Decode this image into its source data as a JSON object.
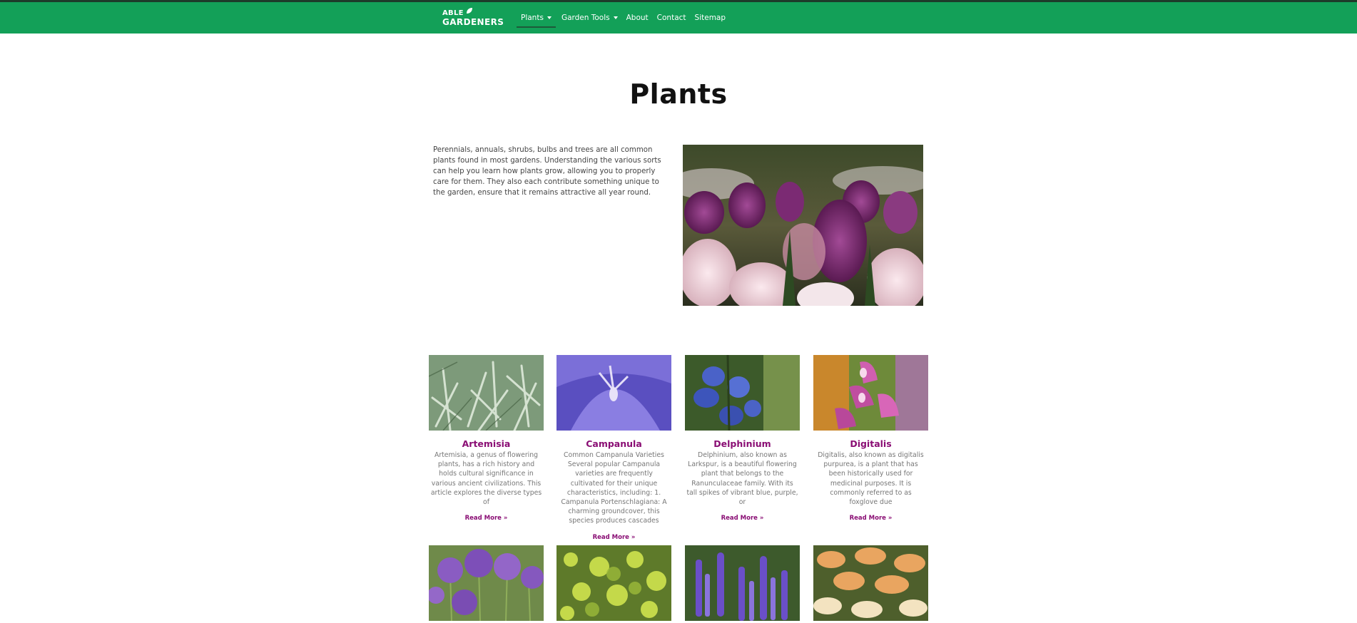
{
  "header": {
    "logo": {
      "line1": "ABLE",
      "line2": "GARDENERS"
    },
    "nav": [
      {
        "label": "Plants",
        "has_dropdown": true,
        "active": true
      },
      {
        "label": "Garden Tools",
        "has_dropdown": true,
        "active": false
      },
      {
        "label": "About",
        "has_dropdown": false,
        "active": false
      },
      {
        "label": "Contact",
        "has_dropdown": false,
        "active": false
      },
      {
        "label": "Sitemap",
        "has_dropdown": false,
        "active": false
      }
    ]
  },
  "main": {
    "title": "Plants",
    "intro": "Perennials, annuals, shrubs, bulbs and trees are all common plants found in most gardens. Understanding the various sorts can help you learn how plants grow, allowing you to properly care for them. They also each contribute something unique to the garden, ensure that it remains attractive all year round."
  },
  "cards": [
    {
      "title": "Artemisia",
      "desc": "Artemisia, a genus of flowering plants, has a rich history and holds cultural significance in various ancient civilizations. This article explores the diverse types of",
      "link": "Read More »"
    },
    {
      "title": "Campanula",
      "desc": "Common Campanula Varieties Several popular Campanula varieties are frequently cultivated for their unique characteristics, including: 1. Campanula Portenschlagiana: A charming groundcover, this species produces cascades",
      "link": "Read More »"
    },
    {
      "title": "Delphinium",
      "desc": "Delphinium, also known as Larkspur, is a beautiful flowering plant that belongs to the Ranunculaceae family. With its tall spikes of vibrant blue, purple, or",
      "link": "Read More »"
    },
    {
      "title": "Digitalis",
      "desc": "Digitalis, also known as digitalis purpurea, is a plant that has been historically used for medicinal purposes. It is commonly referred to as foxglove due",
      "link": "Read More »"
    }
  ],
  "colors": {
    "header_bg": "#13a058",
    "accent": "#8a0e74",
    "title": "#111111"
  }
}
